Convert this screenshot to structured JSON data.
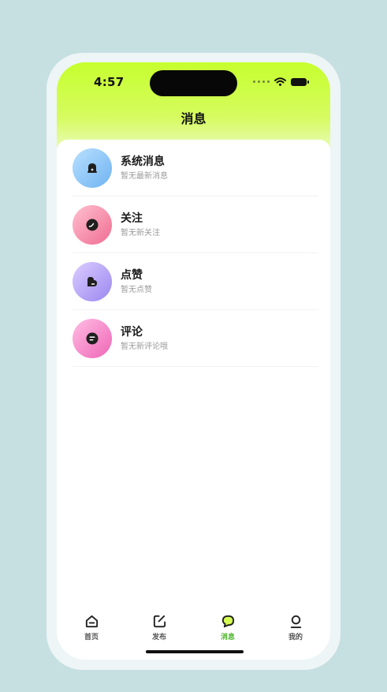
{
  "status_bar": {
    "time": "4:57"
  },
  "header": {
    "title": "消息"
  },
  "messages": [
    {
      "title": "系统消息",
      "subtitle": "暂无最新消息",
      "icon": "bell-icon",
      "avatar_gradient": [
        "#a9d6ff",
        "#6fb6f4"
      ]
    },
    {
      "title": "关注",
      "subtitle": "暂无新关注",
      "icon": "follow-icon",
      "avatar_gradient": [
        "#ffb3c4",
        "#f06d93"
      ]
    },
    {
      "title": "点赞",
      "subtitle": "暂无点赞",
      "icon": "heart-icon",
      "avatar_gradient": [
        "#d7c6ff",
        "#9c8bf2"
      ]
    },
    {
      "title": "评论",
      "subtitle": "暂无新评论哦",
      "icon": "comment-icon",
      "avatar_gradient": [
        "#ffb3dd",
        "#f06cb8"
      ]
    }
  ],
  "tabbar": {
    "items": [
      {
        "label": "首页",
        "icon": "home-icon",
        "active": false
      },
      {
        "label": "发布",
        "icon": "publish-icon",
        "active": false
      },
      {
        "label": "消息",
        "icon": "message-icon",
        "active": true
      },
      {
        "label": "我的",
        "icon": "profile-icon",
        "active": false
      }
    ]
  },
  "colors": {
    "accent": "#c6ff2e",
    "active_tab": "#4cb52a"
  }
}
